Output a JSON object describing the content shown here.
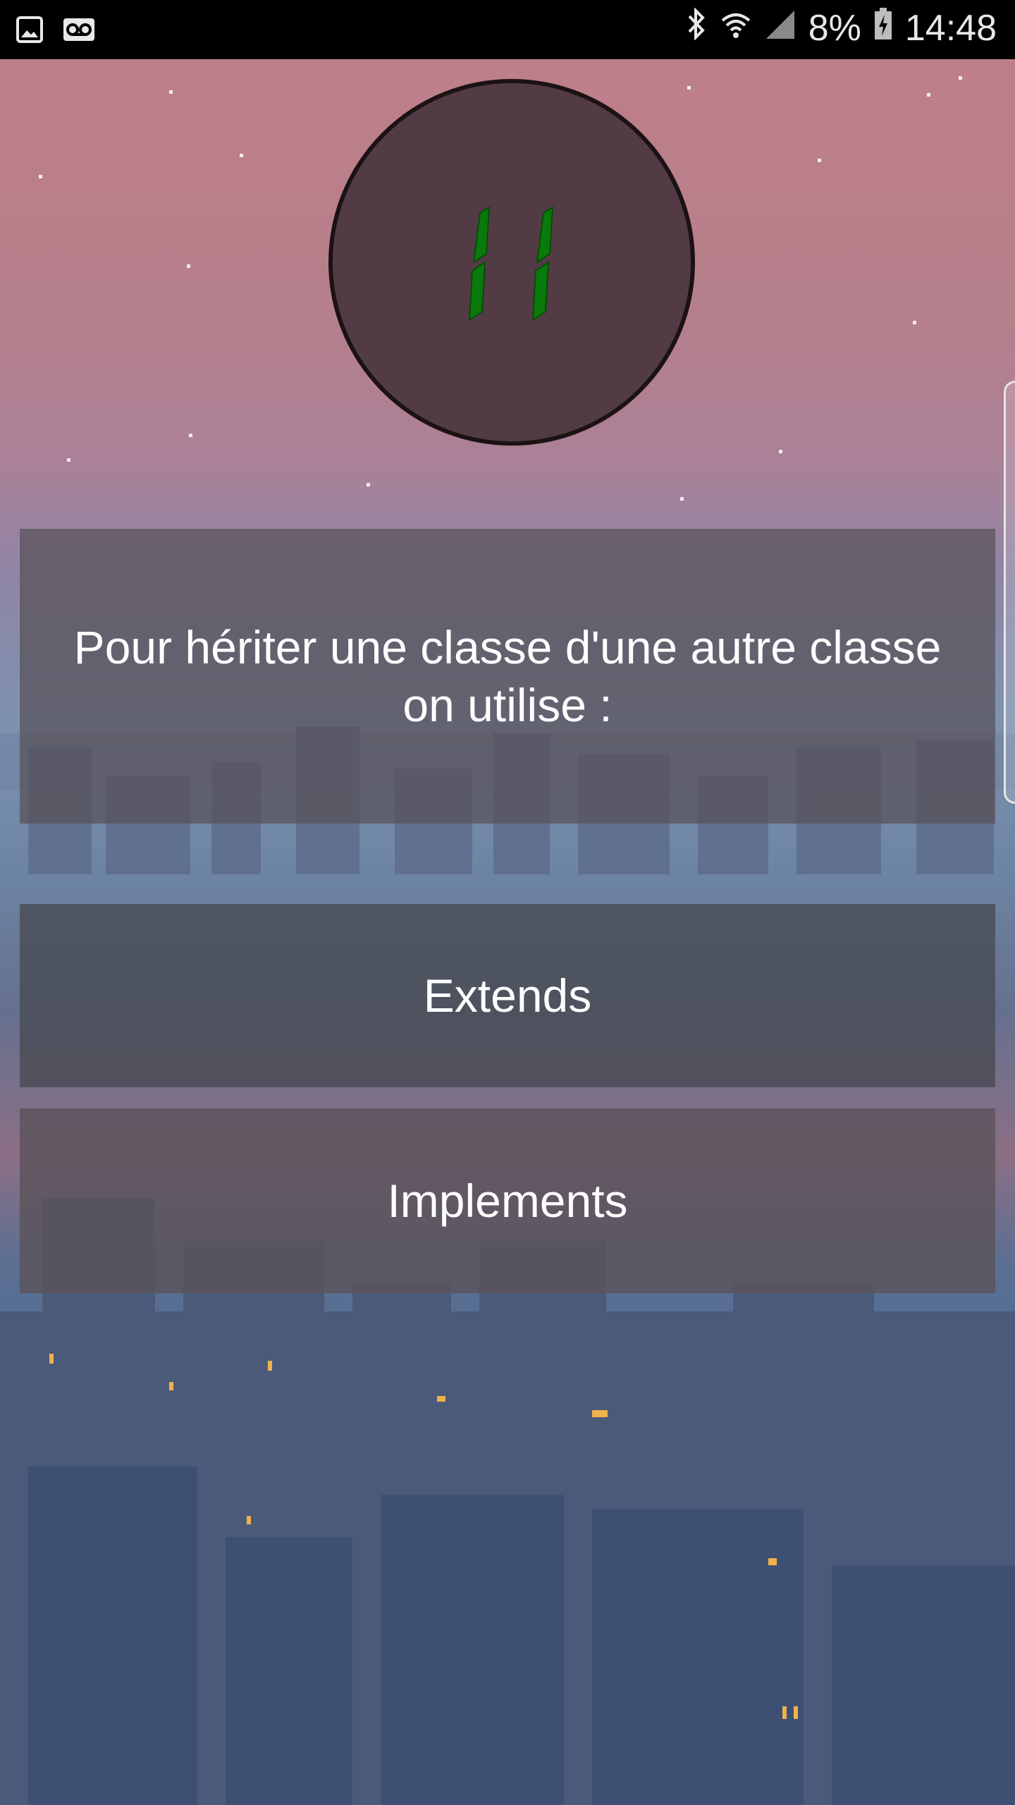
{
  "status_bar": {
    "battery_percent": "8%",
    "time": "14:48",
    "icons": [
      "gallery-icon",
      "voicemail-icon",
      "bluetooth-icon",
      "wifi-icon",
      "signal-icon",
      "battery-charging-icon"
    ]
  },
  "timer": {
    "display": "11",
    "digit_color": "#0a7a0a"
  },
  "quiz": {
    "question": "Pour hériter une classe d'une autre classe on utilise :",
    "answers": [
      "Extends",
      "Implements"
    ]
  },
  "colors": {
    "panel": "#58505a",
    "circle": "#523b45"
  }
}
